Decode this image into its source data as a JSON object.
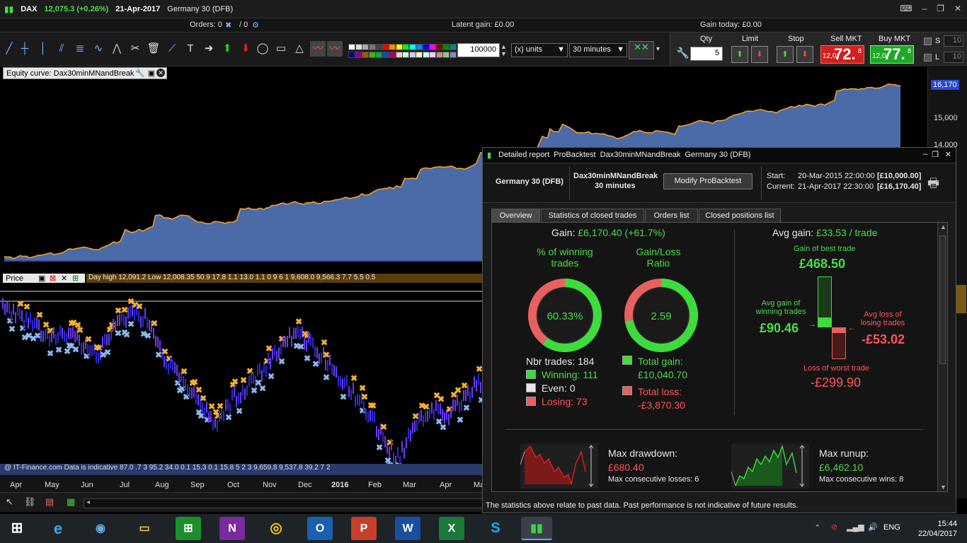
{
  "titlebar": {
    "ticker": "DAX",
    "price": "12,075.3 (+0.26%)",
    "date": "21-Apr-2017",
    "instrument": "Germany 30 (DFB)"
  },
  "ordersbar": {
    "orders_label": "Orders: 0",
    "orders_second": "/ 0",
    "latent_gain": "Latent gain: £0.00",
    "gain_today": "Gain today: £0.00"
  },
  "toolbar": {
    "quantity_value": "100000",
    "units_label": "(x) units",
    "timeframe_label": "30 minutes"
  },
  "orderpanel": {
    "qty_label": "Qty",
    "qty_value": "5",
    "limit_label": "Limit",
    "stop_label": "Stop",
    "sell_label": "Sell MKT",
    "buy_label": "Buy MKT",
    "sell_small": "12,0",
    "sell_big": "72.",
    "sell_sup": "8",
    "buy_small": "12,0",
    "buy_big": "77.",
    "buy_sup": "8",
    "s_label": "S",
    "s_value": "10",
    "l_label": "L",
    "l_value": "10"
  },
  "equity": {
    "header": "Equity curve: Dax30minMNandBreak",
    "last_value_label": "16,170",
    "y_ticks": [
      "15,000",
      "14,000"
    ]
  },
  "price": {
    "header": "Price",
    "daybar": "Day high 12,091.2 Low 12,008.35 50.9 17.8 1.1 13.0 1.1 0 9 6 1 9,608.0 9,566.3 7.7 5.5 0.5",
    "bottom_strip": "@ IT-Finance.com Data is indicative  87.0 .7 3 95.2 34.0 0.1 15.3 0.1 15.8 5 2 3 9,659.8 9,537.8 39.2 7 2",
    "x_ticks": [
      "Apr",
      "May",
      "Jun",
      "Jul",
      "Aug",
      "Sep",
      "Oct",
      "Nov",
      "Dec",
      "2016",
      "Feb",
      "Mar",
      "Apr",
      "Ma"
    ]
  },
  "report": {
    "window_title": "Detailed report  ProBacktest  Dax30minMNandBreak  Germany 30 (DFB)",
    "instrument": "Germany 30 (DFB)",
    "strategy": "Dax30minMNandBreak",
    "timeframe": "30 minutes",
    "modify_button": "Modify ProBacktest",
    "start_label": "Start:",
    "start_value": "20-Mar-2015 22:00:00",
    "start_capital": "[£10,000.00]",
    "current_label": "Current:",
    "current_value": "21-Apr-2017 22:30:00",
    "current_capital": "[£16,170.40]",
    "tabs": [
      "Overview",
      "Statistics of closed trades",
      "Orders list",
      "Closed positions list"
    ],
    "gain_label": "Gain:",
    "gain_value": "£6,170.40 (+61.7%)",
    "winning_pct_title_1": "% of winning",
    "winning_pct_title_2": "trades",
    "winning_pct_value": "60.33%",
    "winning_fraction": 0.6033,
    "ratio_title_1": "Gain/Loss",
    "ratio_title_2": "Ratio",
    "ratio_value": "2.59",
    "ratio_fraction": 0.7217,
    "nbr_trades": "Nbr trades: 184",
    "winning": "Winning: 111",
    "even": "Even: 0",
    "losing": "Losing: 73",
    "total_gain_label": "Total gain:",
    "total_gain_value": "£10,040.70",
    "total_loss_label": "Total loss:",
    "total_loss_value": "-£3,870.30",
    "avg_gain_label": "Avg gain:",
    "avg_gain_value": "£33.53 / trade",
    "best_trade_label": "Gain of best trade",
    "best_trade_value": "£468.50",
    "avg_win_label_1": "Avg gain of",
    "avg_win_label_2": "winning trades",
    "avg_win_value": "£90.46",
    "avg_loss_label_1": "Avg loss of",
    "avg_loss_label_2": "losing trades",
    "avg_loss_value": "-£53.02",
    "worst_trade_label": "Loss of worst trade",
    "worst_trade_value": "-£299.90",
    "max_drawdown_label": "Max drawdown:",
    "max_drawdown_value": "£680.40",
    "max_consec_losses": "Max consecutive losses: 6",
    "max_runup_label": "Max runup:",
    "max_runup_value": "£6,462.10",
    "max_consec_wins": "Max consecutive wins: 8",
    "footnote": "The statistics above relate to past data. Past performance is not indicative of future results."
  },
  "taskbar": {
    "apps": [
      "windows-start",
      "internet-explorer",
      "media-player",
      "file-explorer",
      "store",
      "onenote",
      "chrome",
      "outlook",
      "powerpoint",
      "word",
      "excel",
      "skype",
      "prorealtime"
    ],
    "language": "ENG",
    "time": "15:44",
    "date": "22/04/2017"
  },
  "colors": {
    "gain_green": "#4cdc4c",
    "loss_red": "#ff5555",
    "equity_fill": "#4a6aa8",
    "equity_line": "#f0a030"
  }
}
